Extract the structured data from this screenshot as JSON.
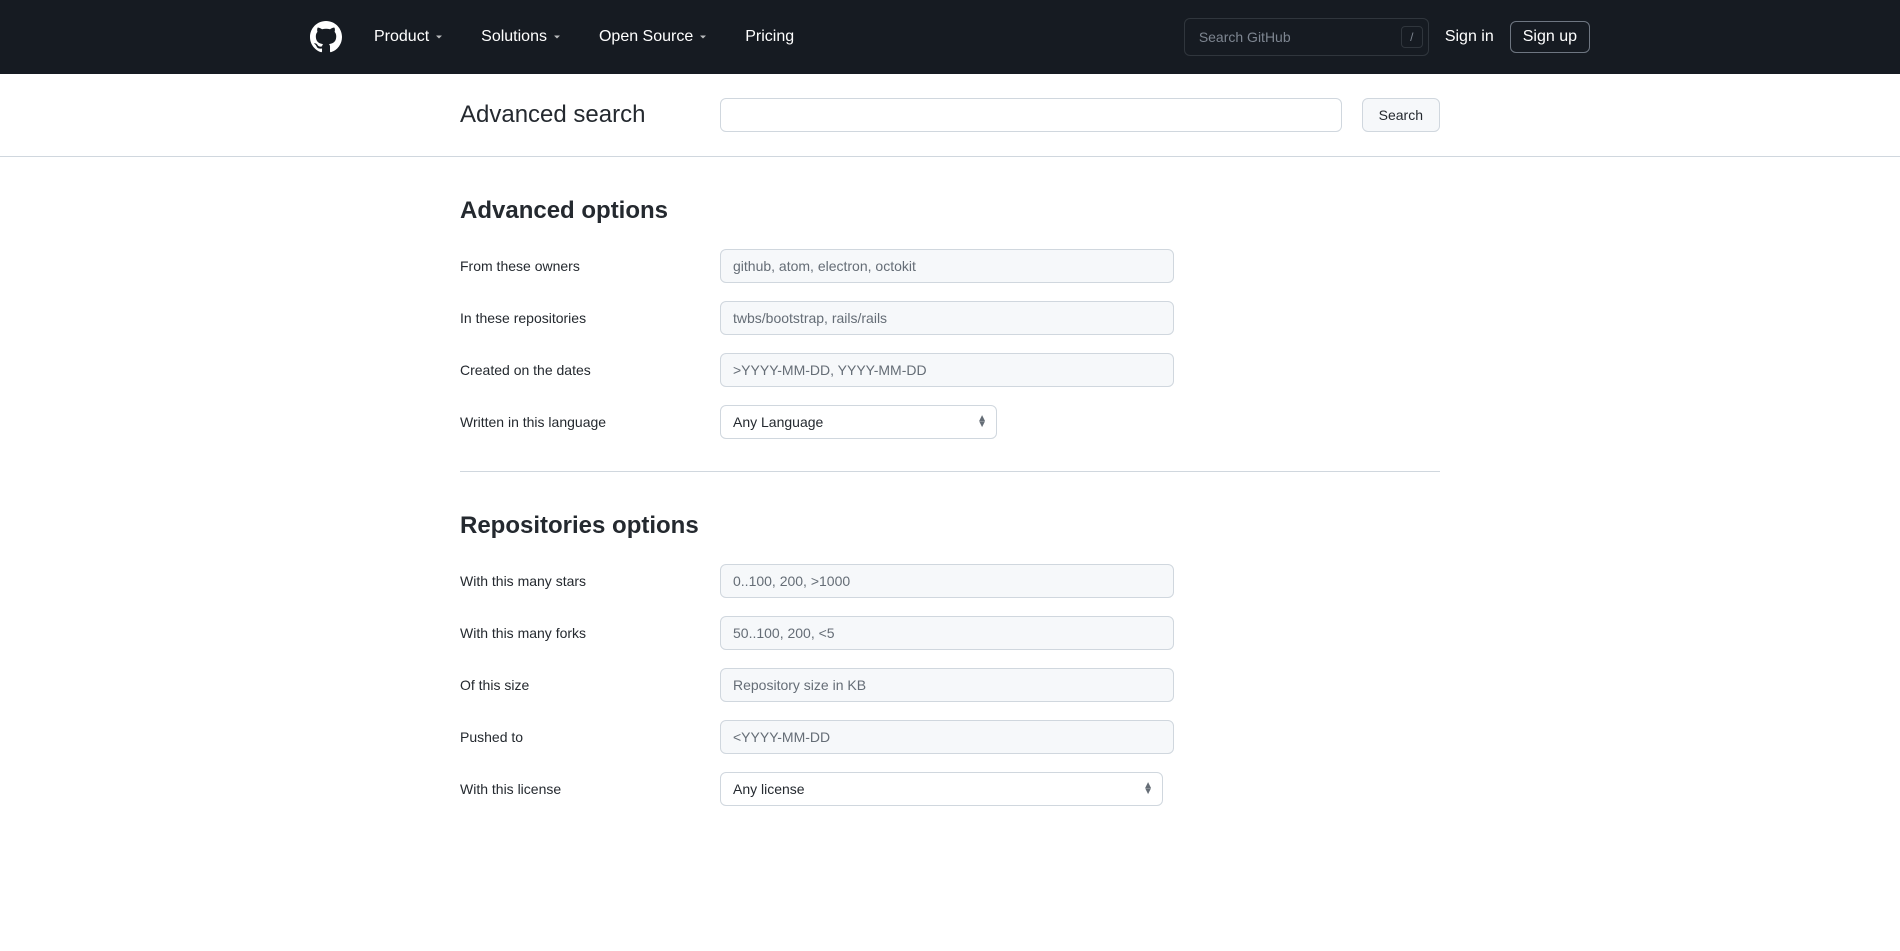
{
  "header": {
    "nav": {
      "product": "Product",
      "solutions": "Solutions",
      "opensource": "Open Source",
      "pricing": "Pricing"
    },
    "search_placeholder": "Search GitHub",
    "search_key": "/",
    "signin": "Sign in",
    "signup": "Sign up"
  },
  "page": {
    "title": "Advanced search",
    "search_button": "Search"
  },
  "advanced": {
    "title": "Advanced options",
    "owners": {
      "label": "From these owners",
      "placeholder": "github, atom, electron, octokit"
    },
    "repos": {
      "label": "In these repositories",
      "placeholder": "twbs/bootstrap, rails/rails"
    },
    "created": {
      "label": "Created on the dates",
      "placeholder": ">YYYY-MM-DD, YYYY-MM-DD"
    },
    "language": {
      "label": "Written in this language",
      "selected": "Any Language"
    }
  },
  "repositories": {
    "title": "Repositories options",
    "stars": {
      "label": "With this many stars",
      "placeholder": "0..100, 200, >1000"
    },
    "forks": {
      "label": "With this many forks",
      "placeholder": "50..100, 200, <5"
    },
    "size": {
      "label": "Of this size",
      "placeholder": "Repository size in KB"
    },
    "pushed": {
      "label": "Pushed to",
      "placeholder": "<YYYY-MM-DD"
    },
    "license": {
      "label": "With this license",
      "selected": "Any license"
    }
  }
}
